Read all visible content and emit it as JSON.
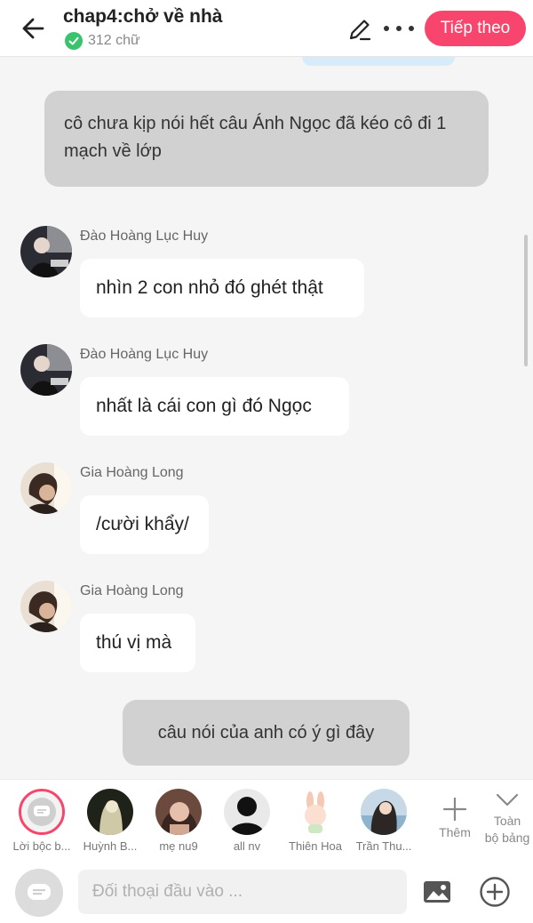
{
  "header": {
    "title": "chap4:chở về nhà",
    "word_count": "312 chữ",
    "next_label": "Tiếp theo"
  },
  "messages": [
    {
      "type": "narration",
      "text": "cô chưa kịp nói hết câu Ánh Ngọc đã kéo cô đi 1 mạch về lớp"
    },
    {
      "type": "chat",
      "sender": "Đào Hoàng Lục Huy",
      "text": "nhìn 2 con nhỏ đó ghét thật"
    },
    {
      "type": "chat",
      "sender": "Đào Hoàng Lục Huy",
      "text": "nhất là cái con gì đó Ngọc"
    },
    {
      "type": "chat",
      "sender": "Gia Hoàng Long",
      "text": "/cười khẩy/"
    },
    {
      "type": "chat",
      "sender": "Gia Hoàng Long",
      "text": "thú vị mà"
    },
    {
      "type": "narration",
      "text": "câu nói của anh có ý gì đây"
    }
  ],
  "characters": [
    {
      "label": "Lời bộc b..."
    },
    {
      "label": "Huỳnh B..."
    },
    {
      "label": "mẹ nu9"
    },
    {
      "label": "all nv"
    },
    {
      "label": "Thiên Hoa"
    },
    {
      "label": "Trần Thu..."
    }
  ],
  "char_actions": {
    "add_label": "Thêm",
    "all_label_line1": "Toàn",
    "all_label_line2": "bộ bảng"
  },
  "input": {
    "placeholder": "Đối thoại đầu vào ..."
  },
  "colors": {
    "accent": "#f7456d",
    "narration_bg": "#d1d1d1",
    "verified": "#3ac26d"
  }
}
